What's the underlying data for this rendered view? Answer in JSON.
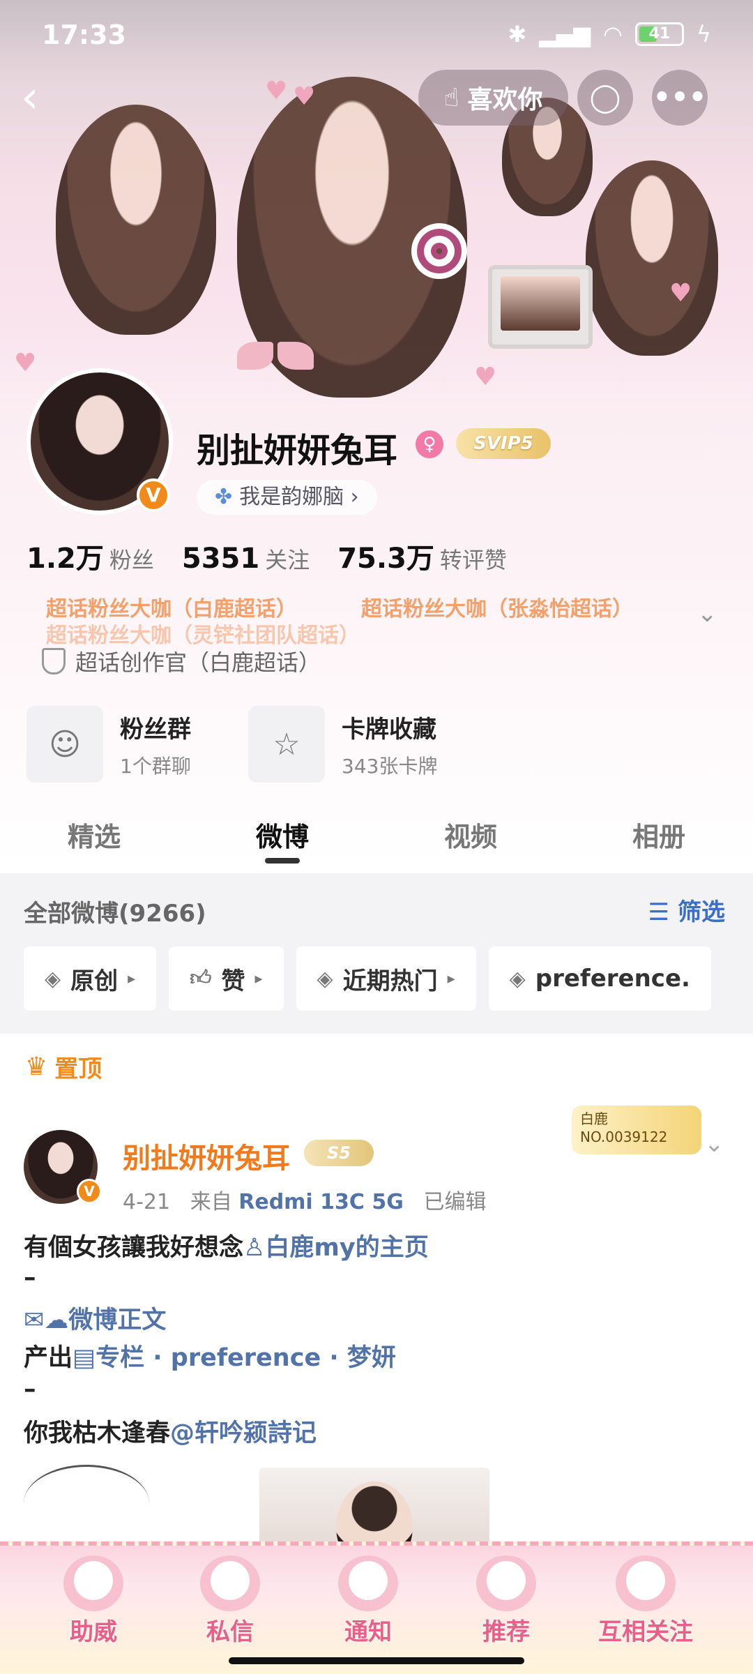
{
  "status_bar": {
    "time": "17:33",
    "battery": "41"
  },
  "header": {
    "like_label": "喜欢你"
  },
  "profile": {
    "name": "别扯妍妍兔耳",
    "vip_label": "SVIP5",
    "tag": "我是韵娜脑",
    "stats": [
      {
        "num": "1.2万",
        "label": "粉丝"
      },
      {
        "num": "5351",
        "label": "关注"
      },
      {
        "num": "75.3万",
        "label": "转评赞"
      }
    ],
    "fan_titles": [
      "超话粉丝大咖（白鹿超话）",
      "超话粉丝大咖（张淼怡超话）",
      "超话粉丝大咖（灵铓社团队超话）"
    ],
    "creator": "超话创作官（白鹿超话）",
    "cards": [
      {
        "title": "粉丝群",
        "sub": "1个群聊"
      },
      {
        "title": "卡牌收藏",
        "sub": "343张卡牌"
      }
    ]
  },
  "tabs": [
    "精选",
    "微博",
    "视频",
    "相册"
  ],
  "filter": {
    "all_count": "全部微博(9266)",
    "filter_label": "筛选",
    "chips": [
      "原创",
      "赞",
      "近期热门",
      "preference."
    ]
  },
  "post": {
    "pinned_label": "置顶",
    "author": "别扯妍妍兔耳",
    "level": "S5",
    "date": "4-21",
    "from_label": "来自",
    "device": "Redmi 13C 5G",
    "edited": "已编辑",
    "fans_badge_top": "白鹿",
    "fans_badge_no": "NO.0039122",
    "line1": "有個女孩讓我好想念",
    "line1_link": "白鹿my的主页",
    "dash": "–",
    "line2_link": "微博正文",
    "line3_prefix": "产出",
    "line3_link": "专栏",
    "line3_rest": "· preference · 梦妍",
    "line4": "你我枯木逢春",
    "line4_link": "@轩吟颍詩记"
  },
  "bottom_nav": [
    "助威",
    "私信",
    "通知",
    "推荐",
    "互相关注"
  ],
  "colors": {
    "accent_orange": "#f07a1c",
    "link_blue": "#5173a8",
    "pink": "#e8608a"
  }
}
